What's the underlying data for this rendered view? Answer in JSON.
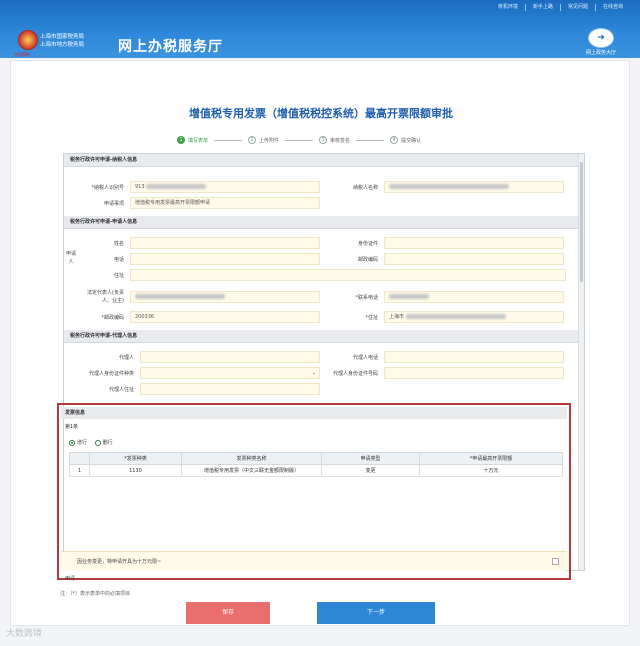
{
  "header": {
    "top_links": [
      "校机环境",
      "新手上路",
      "常见问题",
      "在线咨询"
    ],
    "emblem_caption": "中国税务",
    "org_line1": "上海市国家税务局",
    "org_line2": "上海市地方税务局",
    "title": "网上办税服务厅",
    "exit_label": "网上政务大厅"
  },
  "page": {
    "title": "增值税专用发票（增值税税控系统）最高开票限额审批"
  },
  "steps": [
    {
      "num": "1",
      "label": "填写表单"
    },
    {
      "num": "2",
      "label": "上传附件"
    },
    {
      "num": "3",
      "label": "审核签名"
    },
    {
      "num": "4",
      "label": "提交确认"
    }
  ],
  "taxpayer": {
    "section_title": "税务行政许可申请-纳税人信息",
    "tax_id_label": "*纳税人识别号",
    "tax_id_value": "913",
    "name_label": "纳税人名称",
    "matter_label": "申请事项",
    "matter_value": "增值税专用发票最高开票限额申请"
  },
  "applicant": {
    "section_title": "税务行政许可申请-申请人信息",
    "side_label": "申请人",
    "name_label": "姓名",
    "id_label": "身份证件",
    "phone_label": "电话",
    "postcode_label": "邮政编码",
    "address_label": "住址",
    "legal_rep_label_1": "法定代表人(负责",
    "legal_rep_label_2": "人、业主)",
    "contact_phone_label": "*联系电话",
    "mail_code_label": "*邮政编码",
    "mail_code_value": "200336",
    "address2_label": "*住址",
    "address2_value": "上海市"
  },
  "agent": {
    "section_title": "税务行政许可申请-代理人信息",
    "name_label": "代理人",
    "phone_label": "代理人电话",
    "id_type_label": "代理人身份证件种类",
    "id_number_label": "代理人身份证件号码",
    "address_label": "代理人住址"
  },
  "invoice": {
    "section_title": "发票信息",
    "group_label": "第1条",
    "add_label": "增行",
    "delete_label": "删行",
    "columns": [
      "",
      "*发票种类",
      "发票种类名称",
      "申请类型",
      "*申请最高开票限额"
    ],
    "rows": [
      {
        "index": "1",
        "code": "1130",
        "name": "增值税专用发票（中文三联无金额限制版）",
        "type": "变更",
        "limit": "十万元"
      }
    ],
    "reason_text": "因业务变更，特申请开具为十万元限~",
    "reason_label": "申请"
  },
  "footer": {
    "note": "注：（*）表示表单中的必填项目",
    "save_label": "保存",
    "next_label": "下一步",
    "watermark": "大数跨境"
  }
}
